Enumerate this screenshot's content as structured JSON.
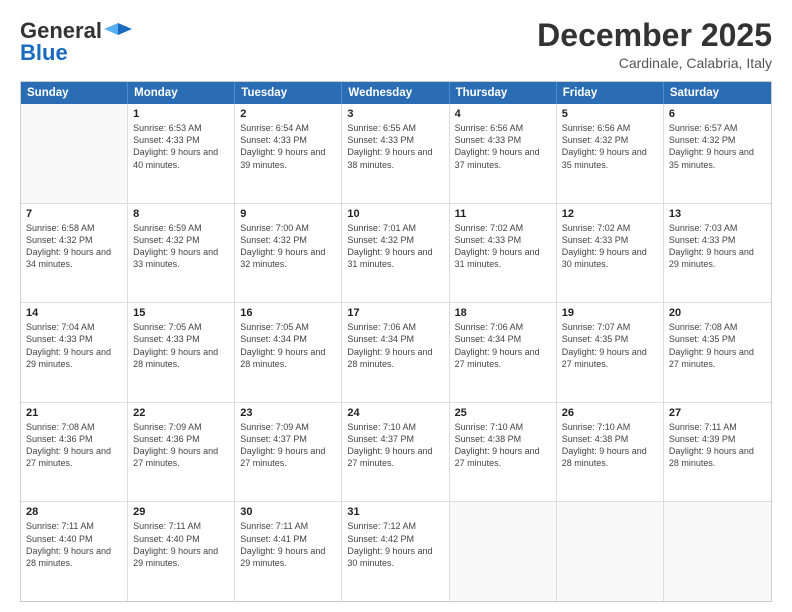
{
  "logo": {
    "general": "General",
    "blue": "Blue"
  },
  "header": {
    "month": "December 2025",
    "location": "Cardinale, Calabria, Italy"
  },
  "days": [
    "Sunday",
    "Monday",
    "Tuesday",
    "Wednesday",
    "Thursday",
    "Friday",
    "Saturday"
  ],
  "rows": [
    [
      {
        "day": "",
        "sunrise": "",
        "sunset": "",
        "daylight": ""
      },
      {
        "day": "1",
        "sunrise": "Sunrise: 6:53 AM",
        "sunset": "Sunset: 4:33 PM",
        "daylight": "Daylight: 9 hours and 40 minutes."
      },
      {
        "day": "2",
        "sunrise": "Sunrise: 6:54 AM",
        "sunset": "Sunset: 4:33 PM",
        "daylight": "Daylight: 9 hours and 39 minutes."
      },
      {
        "day": "3",
        "sunrise": "Sunrise: 6:55 AM",
        "sunset": "Sunset: 4:33 PM",
        "daylight": "Daylight: 9 hours and 38 minutes."
      },
      {
        "day": "4",
        "sunrise": "Sunrise: 6:56 AM",
        "sunset": "Sunset: 4:33 PM",
        "daylight": "Daylight: 9 hours and 37 minutes."
      },
      {
        "day": "5",
        "sunrise": "Sunrise: 6:56 AM",
        "sunset": "Sunset: 4:32 PM",
        "daylight": "Daylight: 9 hours and 35 minutes."
      },
      {
        "day": "6",
        "sunrise": "Sunrise: 6:57 AM",
        "sunset": "Sunset: 4:32 PM",
        "daylight": "Daylight: 9 hours and 35 minutes."
      }
    ],
    [
      {
        "day": "7",
        "sunrise": "Sunrise: 6:58 AM",
        "sunset": "Sunset: 4:32 PM",
        "daylight": "Daylight: 9 hours and 34 minutes."
      },
      {
        "day": "8",
        "sunrise": "Sunrise: 6:59 AM",
        "sunset": "Sunset: 4:32 PM",
        "daylight": "Daylight: 9 hours and 33 minutes."
      },
      {
        "day": "9",
        "sunrise": "Sunrise: 7:00 AM",
        "sunset": "Sunset: 4:32 PM",
        "daylight": "Daylight: 9 hours and 32 minutes."
      },
      {
        "day": "10",
        "sunrise": "Sunrise: 7:01 AM",
        "sunset": "Sunset: 4:32 PM",
        "daylight": "Daylight: 9 hours and 31 minutes."
      },
      {
        "day": "11",
        "sunrise": "Sunrise: 7:02 AM",
        "sunset": "Sunset: 4:33 PM",
        "daylight": "Daylight: 9 hours and 31 minutes."
      },
      {
        "day": "12",
        "sunrise": "Sunrise: 7:02 AM",
        "sunset": "Sunset: 4:33 PM",
        "daylight": "Daylight: 9 hours and 30 minutes."
      },
      {
        "day": "13",
        "sunrise": "Sunrise: 7:03 AM",
        "sunset": "Sunset: 4:33 PM",
        "daylight": "Daylight: 9 hours and 29 minutes."
      }
    ],
    [
      {
        "day": "14",
        "sunrise": "Sunrise: 7:04 AM",
        "sunset": "Sunset: 4:33 PM",
        "daylight": "Daylight: 9 hours and 29 minutes."
      },
      {
        "day": "15",
        "sunrise": "Sunrise: 7:05 AM",
        "sunset": "Sunset: 4:33 PM",
        "daylight": "Daylight: 9 hours and 28 minutes."
      },
      {
        "day": "16",
        "sunrise": "Sunrise: 7:05 AM",
        "sunset": "Sunset: 4:34 PM",
        "daylight": "Daylight: 9 hours and 28 minutes."
      },
      {
        "day": "17",
        "sunrise": "Sunrise: 7:06 AM",
        "sunset": "Sunset: 4:34 PM",
        "daylight": "Daylight: 9 hours and 28 minutes."
      },
      {
        "day": "18",
        "sunrise": "Sunrise: 7:06 AM",
        "sunset": "Sunset: 4:34 PM",
        "daylight": "Daylight: 9 hours and 27 minutes."
      },
      {
        "day": "19",
        "sunrise": "Sunrise: 7:07 AM",
        "sunset": "Sunset: 4:35 PM",
        "daylight": "Daylight: 9 hours and 27 minutes."
      },
      {
        "day": "20",
        "sunrise": "Sunrise: 7:08 AM",
        "sunset": "Sunset: 4:35 PM",
        "daylight": "Daylight: 9 hours and 27 minutes."
      }
    ],
    [
      {
        "day": "21",
        "sunrise": "Sunrise: 7:08 AM",
        "sunset": "Sunset: 4:36 PM",
        "daylight": "Daylight: 9 hours and 27 minutes."
      },
      {
        "day": "22",
        "sunrise": "Sunrise: 7:09 AM",
        "sunset": "Sunset: 4:36 PM",
        "daylight": "Daylight: 9 hours and 27 minutes."
      },
      {
        "day": "23",
        "sunrise": "Sunrise: 7:09 AM",
        "sunset": "Sunset: 4:37 PM",
        "daylight": "Daylight: 9 hours and 27 minutes."
      },
      {
        "day": "24",
        "sunrise": "Sunrise: 7:10 AM",
        "sunset": "Sunset: 4:37 PM",
        "daylight": "Daylight: 9 hours and 27 minutes."
      },
      {
        "day": "25",
        "sunrise": "Sunrise: 7:10 AM",
        "sunset": "Sunset: 4:38 PM",
        "daylight": "Daylight: 9 hours and 27 minutes."
      },
      {
        "day": "26",
        "sunrise": "Sunrise: 7:10 AM",
        "sunset": "Sunset: 4:38 PM",
        "daylight": "Daylight: 9 hours and 28 minutes."
      },
      {
        "day": "27",
        "sunrise": "Sunrise: 7:11 AM",
        "sunset": "Sunset: 4:39 PM",
        "daylight": "Daylight: 9 hours and 28 minutes."
      }
    ],
    [
      {
        "day": "28",
        "sunrise": "Sunrise: 7:11 AM",
        "sunset": "Sunset: 4:40 PM",
        "daylight": "Daylight: 9 hours and 28 minutes."
      },
      {
        "day": "29",
        "sunrise": "Sunrise: 7:11 AM",
        "sunset": "Sunset: 4:40 PM",
        "daylight": "Daylight: 9 hours and 29 minutes."
      },
      {
        "day": "30",
        "sunrise": "Sunrise: 7:11 AM",
        "sunset": "Sunset: 4:41 PM",
        "daylight": "Daylight: 9 hours and 29 minutes."
      },
      {
        "day": "31",
        "sunrise": "Sunrise: 7:12 AM",
        "sunset": "Sunset: 4:42 PM",
        "daylight": "Daylight: 9 hours and 30 minutes."
      },
      {
        "day": "",
        "sunrise": "",
        "sunset": "",
        "daylight": ""
      },
      {
        "day": "",
        "sunrise": "",
        "sunset": "",
        "daylight": ""
      },
      {
        "day": "",
        "sunrise": "",
        "sunset": "",
        "daylight": ""
      }
    ]
  ]
}
